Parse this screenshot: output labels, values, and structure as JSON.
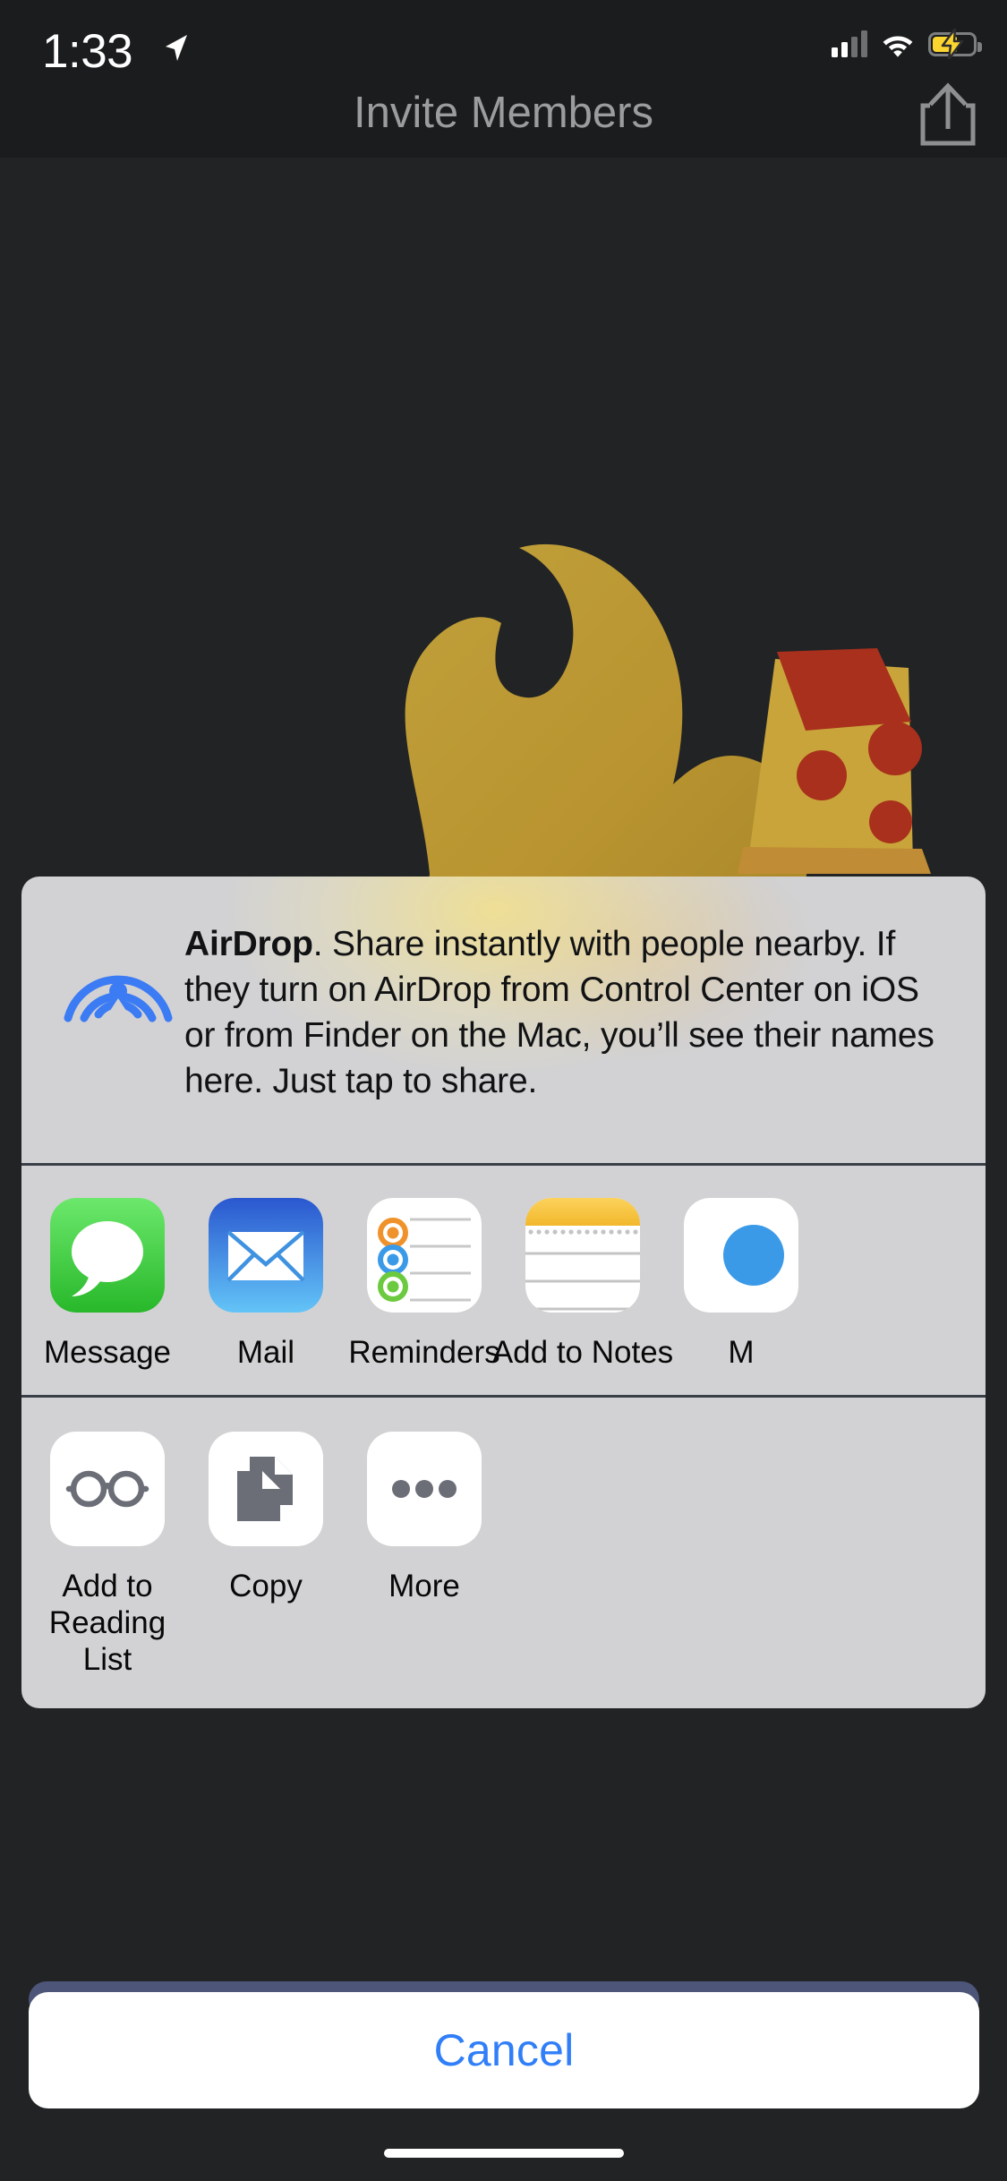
{
  "status_bar": {
    "time": "1:33",
    "location_icon": "location-arrow-icon",
    "signal_icon": "cellular-signal-icon",
    "signal_bars_filled": 2,
    "signal_bars_total": 4,
    "wifi_icon": "wifi-icon",
    "battery_icon": "battery-charging-icon",
    "battery_color": "#fcd430"
  },
  "nav_bar": {
    "title": "Invite Members",
    "share_icon": "share-icon",
    "title_color": "#9a9c9e"
  },
  "background": {
    "illustration": "flame-and-pizza-illustration",
    "flame_color": "#b6942e",
    "pizza_crust_color": "#c9a43a",
    "pepperoni_color": "#a8301c",
    "backdrop_color": "#212325"
  },
  "share_sheet": {
    "panel_color": "#d2d2d4",
    "airdrop": {
      "icon": "airdrop-icon",
      "icon_color": "#3b7bf4",
      "title": "AirDrop",
      "body": ". Share instantly with people nearby. If they turn on AirDrop from Control Center on iOS or from Finder on the Mac, you’ll see their names here. Just tap to share."
    },
    "apps": [
      {
        "label": "Message",
        "icon": "messages-icon"
      },
      {
        "label": "Mail",
        "icon": "mail-icon"
      },
      {
        "label": "Reminders",
        "icon": "reminders-icon"
      },
      {
        "label": "Add to Notes",
        "icon": "notes-icon"
      },
      {
        "label": "M",
        "icon": "partial-app-icon"
      }
    ],
    "actions": [
      {
        "label": "Add to\nReading List",
        "icon": "glasses-icon"
      },
      {
        "label": "Copy",
        "icon": "copy-documents-icon"
      },
      {
        "label": "More",
        "icon": "more-ellipsis-icon"
      }
    ]
  },
  "cancel_button": {
    "label": "Cancel",
    "text_color": "#307ff8"
  }
}
